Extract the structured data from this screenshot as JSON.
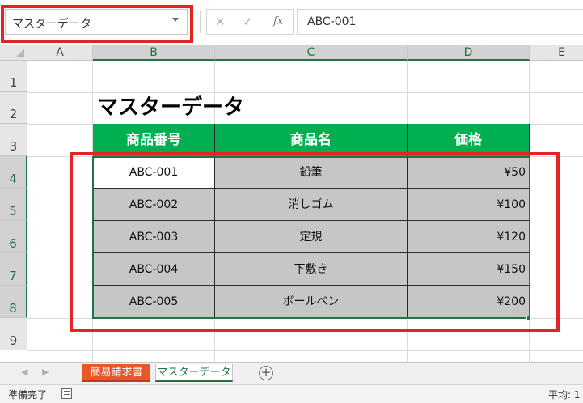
{
  "formula_bar": {
    "name_box_value": "マスターデータ",
    "cancel_glyph": "✕",
    "enter_glyph": "✓",
    "fx_label": "fx",
    "formula_value": "ABC-001"
  },
  "grid": {
    "columns": [
      "A",
      "B",
      "C",
      "D",
      "E"
    ],
    "rows": [
      "1",
      "2",
      "3",
      "4",
      "5",
      "6",
      "7",
      "8",
      "9"
    ]
  },
  "sheet": {
    "title": "マスターデータ",
    "headers": [
      "商品番号",
      "商品名",
      "価格"
    ],
    "products": [
      {
        "code": "ABC-001",
        "name": "鉛筆",
        "price": "¥50"
      },
      {
        "code": "ABC-002",
        "name": "消しゴム",
        "price": "¥100"
      },
      {
        "code": "ABC-003",
        "name": "定規",
        "price": "¥120"
      },
      {
        "code": "ABC-004",
        "name": "下敷き",
        "price": "¥150"
      },
      {
        "code": "ABC-005",
        "name": "ボールペン",
        "price": "¥200"
      }
    ]
  },
  "tabs": {
    "nav_prev": "◀",
    "nav_next": "▶",
    "items": [
      "簡易請求書",
      "マスターデータ"
    ],
    "add": "+"
  },
  "status": {
    "ready": "準備完了",
    "average": "平均: 1"
  },
  "colors": {
    "header_green": "#00b050",
    "selection_green": "#217346",
    "highlight_red": "#e42323",
    "tab_orange": "#e8562a",
    "cell_gray": "#c6c6c6"
  }
}
